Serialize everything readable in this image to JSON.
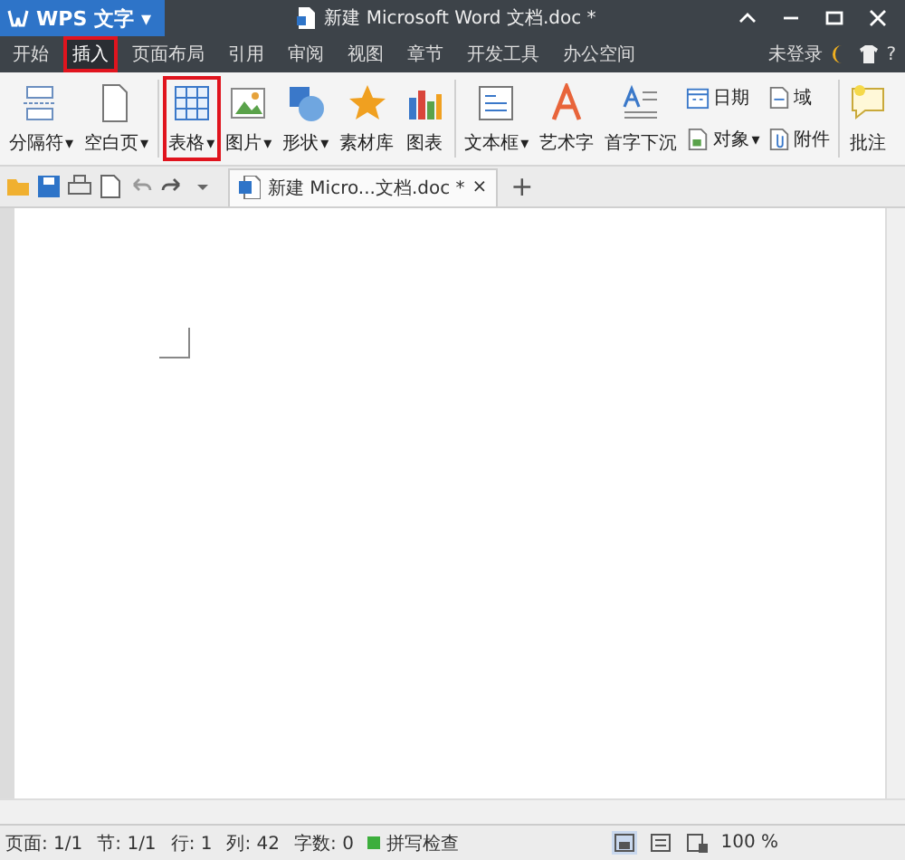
{
  "app_button": {
    "label": "WPS 文字",
    "caret": "▾"
  },
  "window": {
    "title": "新建 Microsoft Word 文档.doc *"
  },
  "menu_tabs": [
    {
      "label": "开始",
      "selected": false,
      "annotated": false
    },
    {
      "label": "插入",
      "selected": true,
      "annotated": true
    },
    {
      "label": "页面布局",
      "selected": false,
      "annotated": false
    },
    {
      "label": "引用",
      "selected": false,
      "annotated": false
    },
    {
      "label": "审阅",
      "selected": false,
      "annotated": false
    },
    {
      "label": "视图",
      "selected": false,
      "annotated": false
    },
    {
      "label": "章节",
      "selected": false,
      "annotated": false
    },
    {
      "label": "开发工具",
      "selected": false,
      "annotated": false
    },
    {
      "label": "办公空间",
      "selected": false,
      "annotated": false
    }
  ],
  "account": {
    "label": "未登录",
    "help": "?"
  },
  "ribbon": [
    {
      "kind": "separator",
      "label": "分隔符",
      "caret": "▾",
      "annotated": false
    },
    {
      "kind": "page",
      "label": "空白页",
      "caret": "▾",
      "annotated": false
    },
    {
      "kind": "divider"
    },
    {
      "kind": "table",
      "label": "表格",
      "caret": "▾",
      "annotated": true
    },
    {
      "kind": "image",
      "label": "图片",
      "caret": "▾",
      "annotated": false
    },
    {
      "kind": "shapes",
      "label": "形状",
      "caret": "▾",
      "annotated": false
    },
    {
      "kind": "star",
      "label": "素材库",
      "annotated": false
    },
    {
      "kind": "chart",
      "label": "图表",
      "annotated": false
    },
    {
      "kind": "divider"
    },
    {
      "kind": "textbox",
      "label": "文本框",
      "caret": "▾",
      "annotated": false
    },
    {
      "kind": "wordart",
      "label": "艺术字",
      "annotated": false
    },
    {
      "kind": "dropcap",
      "label": "首字下沉",
      "annotated": false
    },
    {
      "kind": "column",
      "items": [
        {
          "kind": "calendar",
          "label": "日期"
        },
        {
          "kind": "object",
          "label": "对象",
          "caret": "▾"
        }
      ]
    },
    {
      "kind": "column",
      "items": [
        {
          "kind": "field",
          "label": "域"
        },
        {
          "kind": "attach",
          "label": "附件"
        }
      ]
    },
    {
      "kind": "divider"
    },
    {
      "kind": "comment",
      "label": "批注",
      "annotated": false
    }
  ],
  "doc_tabs": [
    {
      "label": "新建 Micro...文档.doc *",
      "selected": true,
      "close": "×"
    }
  ],
  "new_tab": "+",
  "status_bar": {
    "items": [
      "页面: 1/1",
      "节: 1/1",
      "行: 1",
      "列: 42",
      "字数: 0"
    ],
    "spell_check": "拼写检查",
    "zoom": "100 %"
  }
}
